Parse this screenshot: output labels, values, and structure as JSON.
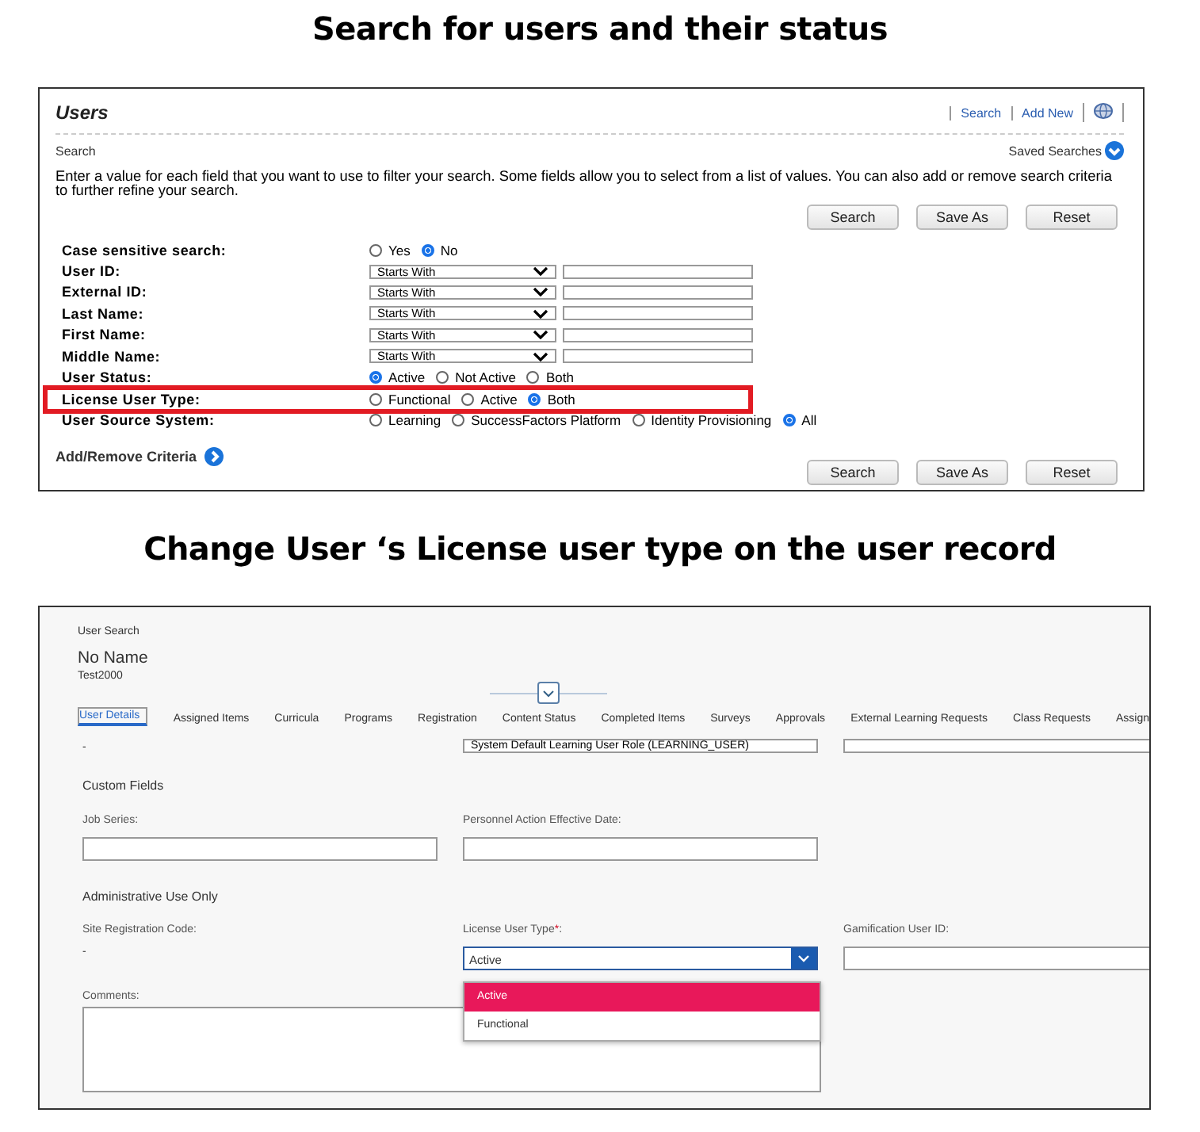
{
  "search_heading": "Search for users and their status",
  "users_search": {
    "title": "Users",
    "links": [
      "Search",
      "Add New"
    ],
    "section": "Search",
    "saved_searches": "Saved Searches",
    "instructions": "Enter a value for each field that you want to use to filter your search. Some fields allow you to select from a list of values. You can also add or remove search criteria to further refine your search.",
    "buttons": [
      "Search",
      "Save As",
      "Reset"
    ],
    "criteria": [
      {
        "label": "Case sensitive search:",
        "kind": "radio",
        "highlighted": false,
        "options": [
          {
            "label": "Yes",
            "selected": false
          },
          {
            "label": "No",
            "selected": true
          }
        ]
      },
      {
        "label": "User ID:",
        "kind": "text",
        "operator": "Starts With"
      },
      {
        "label": "External ID:",
        "kind": "text",
        "operator": "Starts With"
      },
      {
        "label": "Last Name:",
        "kind": "text",
        "operator": "Starts With"
      },
      {
        "label": "First Name:",
        "kind": "text",
        "operator": "Starts With"
      },
      {
        "label": "Middle Name:",
        "kind": "text",
        "operator": "Starts With"
      },
      {
        "label": "User Status:",
        "kind": "radio",
        "highlighted": false,
        "options": [
          {
            "label": "Active",
            "selected": true
          },
          {
            "label": "Not Active",
            "selected": false
          },
          {
            "label": "Both",
            "selected": false
          }
        ]
      },
      {
        "label": "License User Type:",
        "kind": "radio",
        "highlighted": true,
        "options": [
          {
            "label": "Functional",
            "selected": false
          },
          {
            "label": "Active",
            "selected": false
          },
          {
            "label": "Both",
            "selected": true
          }
        ]
      },
      {
        "label": "User Source System:",
        "kind": "radio",
        "highlighted": false,
        "options": [
          {
            "label": "Learning",
            "selected": false
          },
          {
            "label": "SuccessFactors Platform",
            "selected": false
          },
          {
            "label": "Identity Provisioning",
            "selected": false
          },
          {
            "label": "All",
            "selected": true
          }
        ]
      }
    ],
    "add_remove": "Add/Remove Criteria",
    "bottom_buttons": [
      "Search",
      "Save As",
      "Reset"
    ]
  },
  "record_heading": "Change User ‘s License user type on the user record",
  "user_record": {
    "breadcrumb": "User Search",
    "name": "No Name",
    "user_id": "Test2000",
    "tabs": [
      {
        "label": "User Details",
        "selected": true
      },
      {
        "label": "Assigned Items",
        "selected": false
      },
      {
        "label": "Curricula",
        "selected": false
      },
      {
        "label": "Programs",
        "selected": false
      },
      {
        "label": "Registration",
        "selected": false
      },
      {
        "label": "Content Status",
        "selected": false
      },
      {
        "label": "Completed Items",
        "selected": false
      },
      {
        "label": "Surveys",
        "selected": false
      },
      {
        "label": "Approvals",
        "selected": false
      },
      {
        "label": "External Learning Requests",
        "selected": false
      },
      {
        "label": "Class Requests",
        "selected": false
      },
      {
        "label": "Assign",
        "selected": false
      }
    ],
    "cut_row": {
      "value": "-",
      "role": "System Default Learning User Role (LEARNING_USER)"
    },
    "custom_fields": {
      "title": "Custom Fields",
      "fields": [
        {
          "label": "Job Series:"
        },
        {
          "label": "Personnel Action Effective Date:"
        }
      ]
    },
    "admin": {
      "title": "Administrative Use Only",
      "site_code_label": "Site Registration Code:",
      "site_code_value": "-",
      "license_label": "License User Type",
      "required_mark": "*",
      "label_suffix": ":",
      "license_value": "Active",
      "options": [
        {
          "label": "Active",
          "selected": true
        },
        {
          "label": "Functional",
          "selected": false
        }
      ],
      "gamification_label": "Gamification User ID:",
      "comments_label": "Comments:"
    }
  }
}
